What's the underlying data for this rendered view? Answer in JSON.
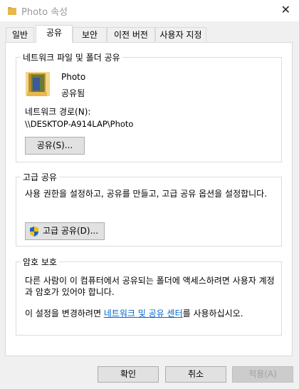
{
  "window": {
    "title": "Photo 속성",
    "close_glyph": "✕"
  },
  "tabs": [
    {
      "label": "일반"
    },
    {
      "label": "공유"
    },
    {
      "label": "보안"
    },
    {
      "label": "이전 버전"
    },
    {
      "label": "사용자 지정"
    }
  ],
  "network_share": {
    "group_title": "네트워크 파일 및 폴더 공유",
    "folder_name": "Photo",
    "folder_status": "공유됨",
    "path_label": "네트워크 경로(N):",
    "path_value": "\\\\DESKTOP-A914LAP\\Photo",
    "share_button": "공유(S)..."
  },
  "advanced_share": {
    "group_title": "고급 공유",
    "description": "사용 권한을 설정하고, 공유를 만들고, 고급 공유 옵션을 설정합니다.",
    "button": "고급 공유(D)..."
  },
  "password_protection": {
    "group_title": "암호 보호",
    "description": "다른 사람이 이 컴퓨터에서 공유되는 폴더에 액세스하려면 사용자 계정과 암호가 있어야 합니다.",
    "change_prefix": "이 설정을 변경하려면 ",
    "link_text": "네트워크 및 공유 센터",
    "change_suffix": "를 사용하십시오."
  },
  "footer": {
    "ok": "확인",
    "cancel": "취소",
    "apply": "적용(A)"
  },
  "colors": {
    "link": "#0066cc",
    "shield_blue": "#1e64c8",
    "shield_yellow": "#f2c200"
  }
}
